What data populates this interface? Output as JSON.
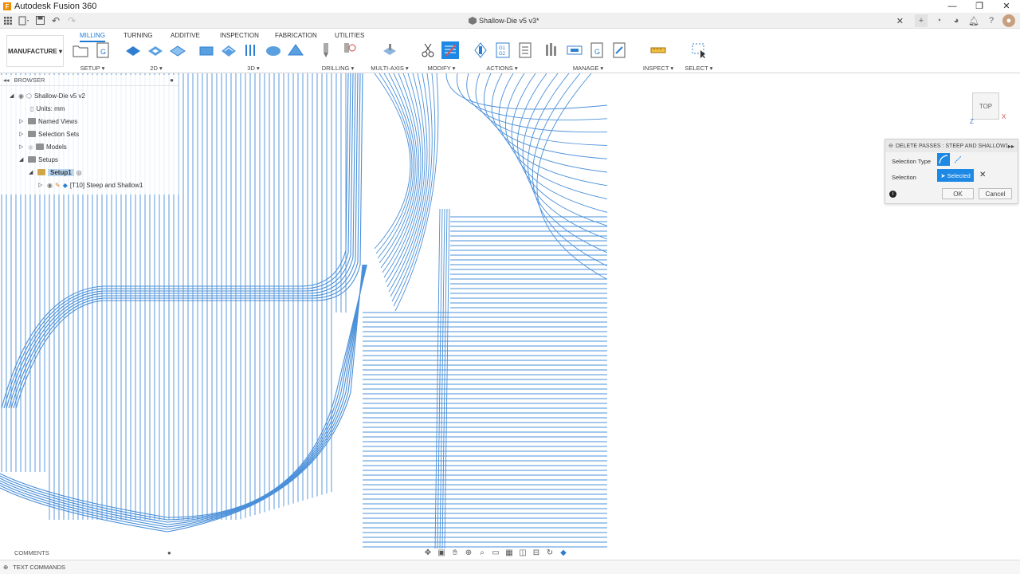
{
  "window": {
    "app_title": "Autodesk Fusion 360",
    "controls": [
      "—",
      "❐",
      "✕"
    ]
  },
  "document": {
    "title": "Shallow-Die v5 v3*",
    "close": "✕"
  },
  "ribbon": {
    "workspace": "MANUFACTURE ▾",
    "tabs": [
      "MILLING",
      "TURNING",
      "ADDITIVE",
      "INSPECTION",
      "FABRICATION",
      "UTILITIES"
    ],
    "groups": {
      "setup": "SETUP ▾",
      "2d": "2D ▾",
      "3d": "3D ▾",
      "drilling": "DRILLING ▾",
      "multiaxis": "MULTI-AXIS ▾",
      "modify": "MODIFY ▾",
      "actions": "ACTIONS ▾",
      "manage": "MANAGE ▾",
      "inspect": "INSPECT ▾",
      "select": "SELECT ▾"
    }
  },
  "browser": {
    "header": "BROWSER",
    "collapse": "◂◂",
    "pin": "●",
    "root": "Shallow-Die v5 v2",
    "units": "Units: mm",
    "named_views": "Named Views",
    "selection_sets": "Selection Sets",
    "models": "Models",
    "setups": "Setups",
    "setup1": "Setup1",
    "operation": "[T10] Steep and Shallow1"
  },
  "viewcube": {
    "face": "TOP",
    "axis_x": "X",
    "axis_z": "Z"
  },
  "dialog": {
    "title": "DELETE PASSES : STEEP AND SHALLOW1",
    "expand": "▸▸",
    "selection_type_label": "Selection Type",
    "selection_label": "Selection",
    "selected_value": "Selected",
    "clear": "✕",
    "info": "i",
    "ok": "OK",
    "cancel": "Cancel"
  },
  "bottom": {
    "comments": "COMMENTS",
    "text_commands": "TEXT COMMANDS"
  },
  "colors": {
    "toolpath": "#4a90d9",
    "accent": "#1e88e5"
  }
}
